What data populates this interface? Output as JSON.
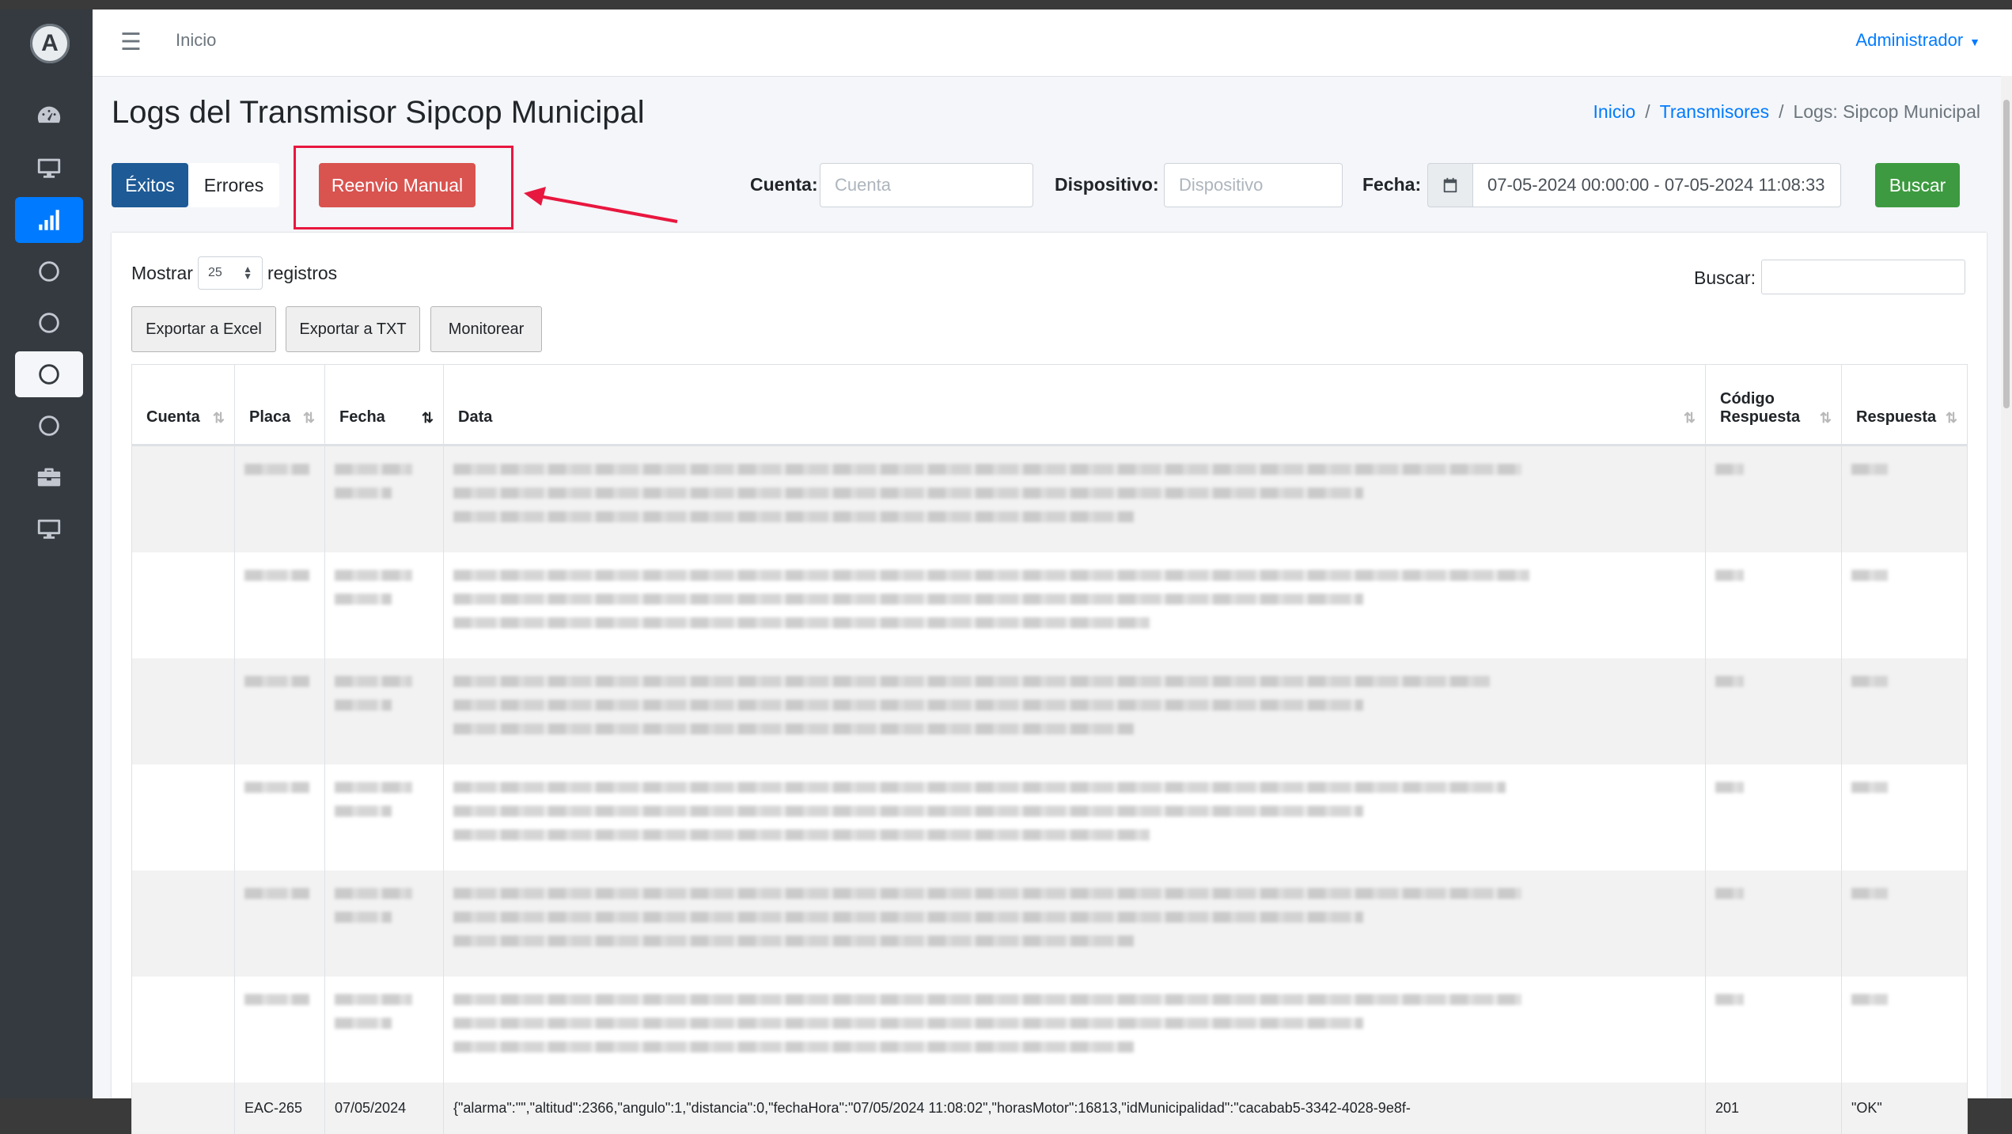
{
  "topbar": {
    "home_link": "Inicio",
    "user_menu": "Administrador"
  },
  "sidebar": {
    "logo_letter": "A",
    "items": [
      {
        "icon": "dashboard-gauge-icon"
      },
      {
        "icon": "desktop-icon"
      },
      {
        "icon": "signal-bars-icon",
        "active": true
      },
      {
        "icon": "circle-icon"
      },
      {
        "icon": "circle-icon"
      },
      {
        "icon": "circle-icon",
        "selected": true
      },
      {
        "icon": "circle-icon"
      },
      {
        "icon": "toolbox-icon"
      },
      {
        "icon": "desktop-icon"
      }
    ]
  },
  "header": {
    "title": "Logs del Transmisor Sipcop Municipal",
    "breadcrumb": [
      "Inicio",
      "Transmisores",
      "Logs: Sipcop Municipal"
    ]
  },
  "filters": {
    "tab_exitos": "Éxitos",
    "tab_errores": "Errores",
    "reenvio_label": "Reenvio Manual",
    "cuenta_label": "Cuenta:",
    "cuenta_placeholder": "Cuenta",
    "dispositivo_label": "Dispositivo:",
    "dispositivo_placeholder": "Dispositivo",
    "fecha_label": "Fecha:",
    "fecha_value": "07-05-2024 00:00:00 - 07-05-2024 11:08:33",
    "buscar_button": "Buscar"
  },
  "table_controls": {
    "mostrar": "Mostrar",
    "page_size": "25",
    "registros": "registros",
    "buscar_label": "Buscar:",
    "export_excel": "Exportar a Excel",
    "export_txt": "Exportar a TXT",
    "monitorear": "Monitorear"
  },
  "table": {
    "columns": [
      "Cuenta",
      "Placa",
      "Fecha",
      "Data",
      "Código Respuesta",
      "Respuesta"
    ],
    "visible_row": {
      "cuenta": "",
      "placa": "EAC-265",
      "fecha": "07/05/2024",
      "data": "{\"alarma\":\"\",\"altitud\":2366,\"angulo\":1,\"distancia\":0,\"fechaHora\":\"07/05/2024 11:08:02\",\"horasMotor\":16813,\"idMunicipalidad\":\"cacabab5-3342-4028-9e8f-",
      "codigo": "201",
      "respuesta": "\"OK\""
    }
  }
}
